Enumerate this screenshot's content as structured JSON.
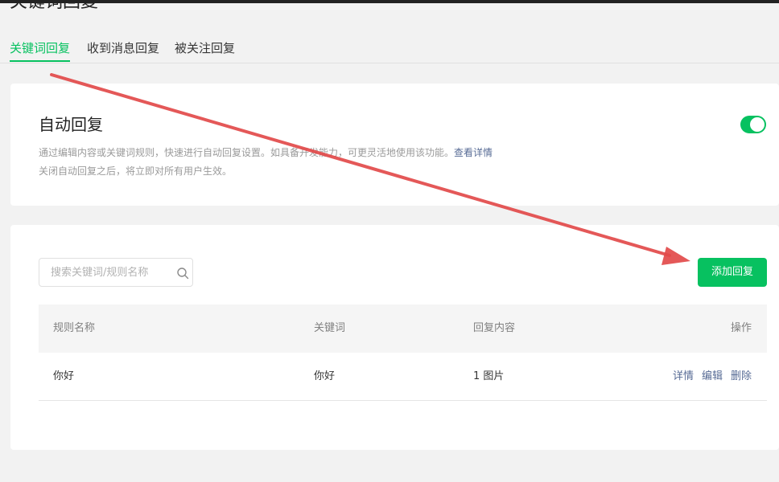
{
  "page": {
    "title": "关键词回复"
  },
  "tabs": [
    {
      "label": "关键词回复",
      "active": true
    },
    {
      "label": "收到消息回复",
      "active": false
    },
    {
      "label": "被关注回复",
      "active": false
    }
  ],
  "auto_reply": {
    "title": "自动回复",
    "desc_line1": "通过编辑内容或关键词规则，快速进行自动回复设置。如具备开发能力，可更灵活地使用该功能。",
    "detail_link": "查看详情",
    "desc_line2": "关闭自动回复之后，将立即对所有用户生效。",
    "enabled": true
  },
  "search": {
    "placeholder": "搜索关键词/规则名称",
    "value": ""
  },
  "add_button": "添加回复",
  "table": {
    "headers": [
      "规则名称",
      "关键词",
      "回复内容",
      "操作"
    ],
    "rows": [
      {
        "name": "你好",
        "keyword": "你好",
        "content": "1 图片",
        "ops": [
          "详情",
          "编辑",
          "删除"
        ]
      }
    ]
  },
  "colors": {
    "accent": "#07c160",
    "link": "#576b95",
    "annotation_arrow": "#e24a4a"
  },
  "icons": {
    "search": "search-icon",
    "annotation": "arrow-icon"
  }
}
